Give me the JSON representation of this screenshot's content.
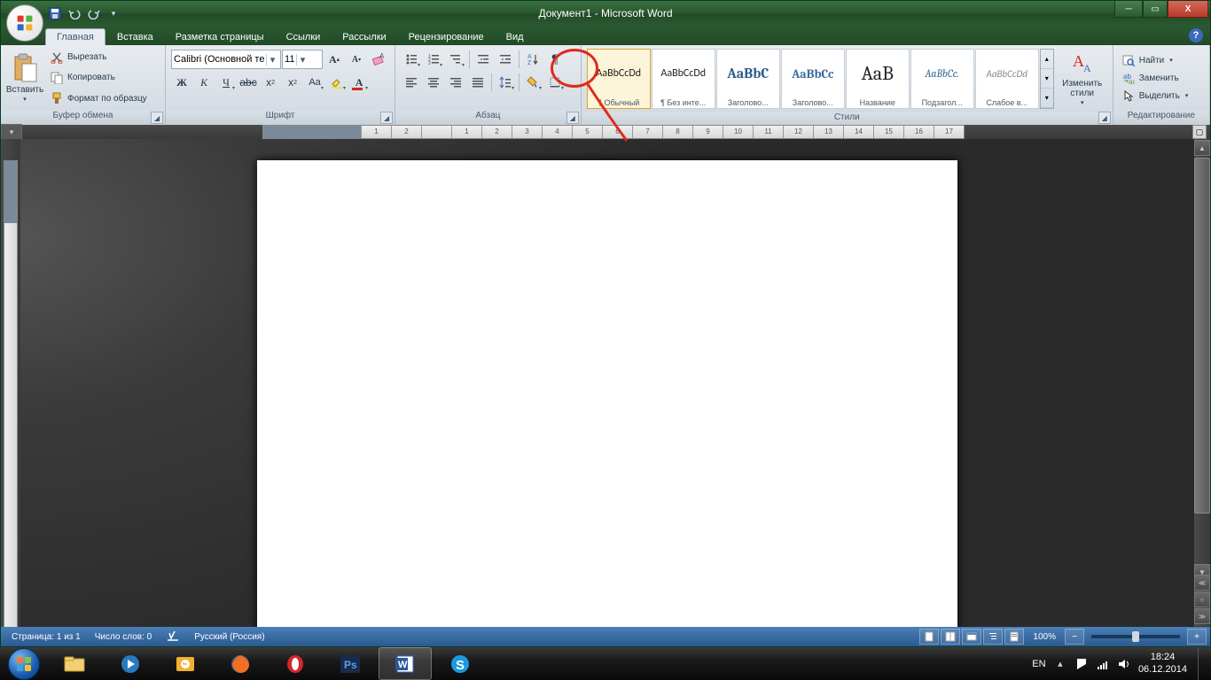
{
  "window": {
    "title": "Документ1 - Microsoft Word"
  },
  "tabs": {
    "home": "Главная",
    "insert": "Вставка",
    "layout": "Разметка страницы",
    "refs": "Ссылки",
    "mail": "Рассылки",
    "review": "Рецензирование",
    "view": "Вид"
  },
  "clipboard": {
    "paste": "Вставить",
    "cut": "Вырезать",
    "copy": "Копировать",
    "format": "Формат по образцу",
    "label": "Буфер обмена"
  },
  "font": {
    "family": "Calibri (Основной те",
    "size": "11",
    "label": "Шрифт"
  },
  "paragraph": {
    "label": "Абзац"
  },
  "styles": {
    "label": "Стили",
    "change": "Изменить стили",
    "items": [
      {
        "preview": "AaBbCcDd",
        "name": "¶ Обычный",
        "css": "font-family:Calibri;font-size:12px;color:#222"
      },
      {
        "preview": "AaBbCcDd",
        "name": "¶ Без инте...",
        "css": "font-family:Calibri;font-size:12px;color:#222"
      },
      {
        "preview": "AaBbC",
        "name": "Заголово...",
        "css": "font-family:Cambria;font-size:16px;color:#2a5a8a;font-weight:bold"
      },
      {
        "preview": "AaBbCc",
        "name": "Заголово...",
        "css": "font-family:Cambria;font-size:14px;color:#3a6a9a;font-weight:bold"
      },
      {
        "preview": "AaB",
        "name": "Название",
        "css": "font-family:Cambria;font-size:22px;color:#222"
      },
      {
        "preview": "AaBbCc.",
        "name": "Подзагол...",
        "css": "font-family:Cambria;font-size:12px;color:#3a6a9a;font-style:italic"
      },
      {
        "preview": "AaBbCcDd",
        "name": "Слабое в...",
        "css": "font-family:Calibri;font-size:11px;color:#888;font-style:italic"
      }
    ]
  },
  "editing": {
    "find": "Найти",
    "replace": "Заменить",
    "select": "Выделить",
    "label": "Редактирование"
  },
  "status": {
    "page": "Страница: 1 из 1",
    "words": "Число слов: 0",
    "lang": "Русский (Россия)",
    "zoom": "100%"
  },
  "tray": {
    "lang": "EN",
    "time": "18:24",
    "date": "06.12.2014"
  },
  "ruler_ticks": [
    "1",
    "2",
    "",
    "1",
    "2",
    "3",
    "4",
    "5",
    "6",
    "7",
    "8",
    "9",
    "10",
    "11",
    "12",
    "13",
    "14",
    "15",
    "16",
    "17"
  ]
}
